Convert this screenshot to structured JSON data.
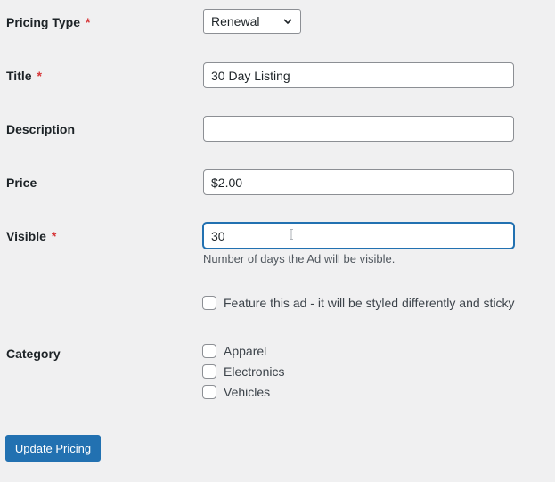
{
  "form": {
    "pricing_type": {
      "label": "Pricing Type",
      "required": "*",
      "selected": "Renewal"
    },
    "title": {
      "label": "Title",
      "required": "*",
      "value": "30 Day Listing"
    },
    "description": {
      "label": "Description",
      "value": ""
    },
    "price": {
      "label": "Price",
      "value": "$2.00"
    },
    "visible": {
      "label": "Visible",
      "required": "*",
      "value": "30",
      "help": "Number of days the Ad will be visible."
    },
    "feature": {
      "label": "Feature this ad - it will be styled differently and sticky",
      "checked": false
    },
    "category": {
      "label": "Category",
      "options": [
        {
          "label": "Apparel",
          "checked": false
        },
        {
          "label": "Electronics",
          "checked": false
        },
        {
          "label": "Vehicles",
          "checked": false
        }
      ]
    },
    "submit_label": "Update Pricing"
  },
  "colors": {
    "accent": "#2271b1",
    "required": "#d63638",
    "background": "#f0f0f1"
  }
}
